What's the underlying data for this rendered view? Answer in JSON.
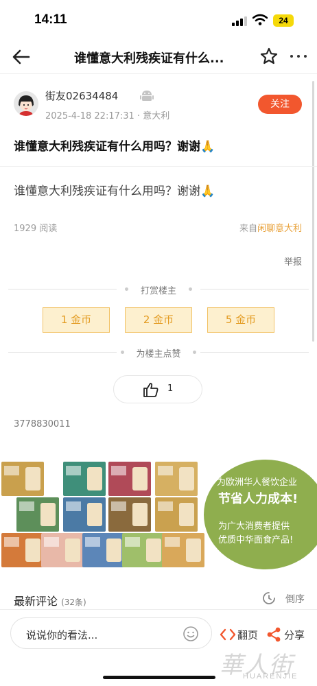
{
  "status_bar": {
    "time": "14:11",
    "battery": "24",
    "battery_color": "#f5d90a"
  },
  "nav": {
    "title": "谁懂意大利残疾证有什么...",
    "back_icon": "arrow-left-icon",
    "star_icon": "star-outline-icon",
    "more_icon": "more-dots-icon"
  },
  "post": {
    "author": "街友02634484",
    "datetime_location": "2025-4-18 22:17:31 · 意大利",
    "follow_label": "关注",
    "title": "谁懂意大利残疾证有什么用吗？谢谢🙏",
    "body": "谁懂意大利残疾证有什么用吗？谢谢🙏",
    "read_count": "1929 阅读",
    "source_prefix": "来自",
    "source_link": "闲聊意大利",
    "report_label": "举报",
    "id": "3778830011"
  },
  "reward": {
    "heading": "打赏楼主",
    "coins": [
      "1 金币",
      "2 金币",
      "5 金币"
    ],
    "like_heading": "为楼主点赞",
    "like_count": "1"
  },
  "ad": {
    "line1": "为欧洲华人餐饮企业",
    "line2": "节省人力成本!",
    "line3": "为广大消费者提供",
    "line4": "优质中华面食产品!"
  },
  "comments": {
    "title": "最新评论",
    "count": "(32条)",
    "sort_label": "倒序"
  },
  "bottom": {
    "input_placeholder": "说说你的看法...",
    "page_label": "翻页",
    "share_label": "分享"
  },
  "watermark": {
    "cn": "華人街",
    "en": "HUARENJIE"
  },
  "colors": {
    "accent": "#f2572e",
    "coin_bg": "#fdf0cf",
    "coin_text": "#e39a1f",
    "source_link": "#e8a037",
    "ad_green": "#8fae4e"
  }
}
